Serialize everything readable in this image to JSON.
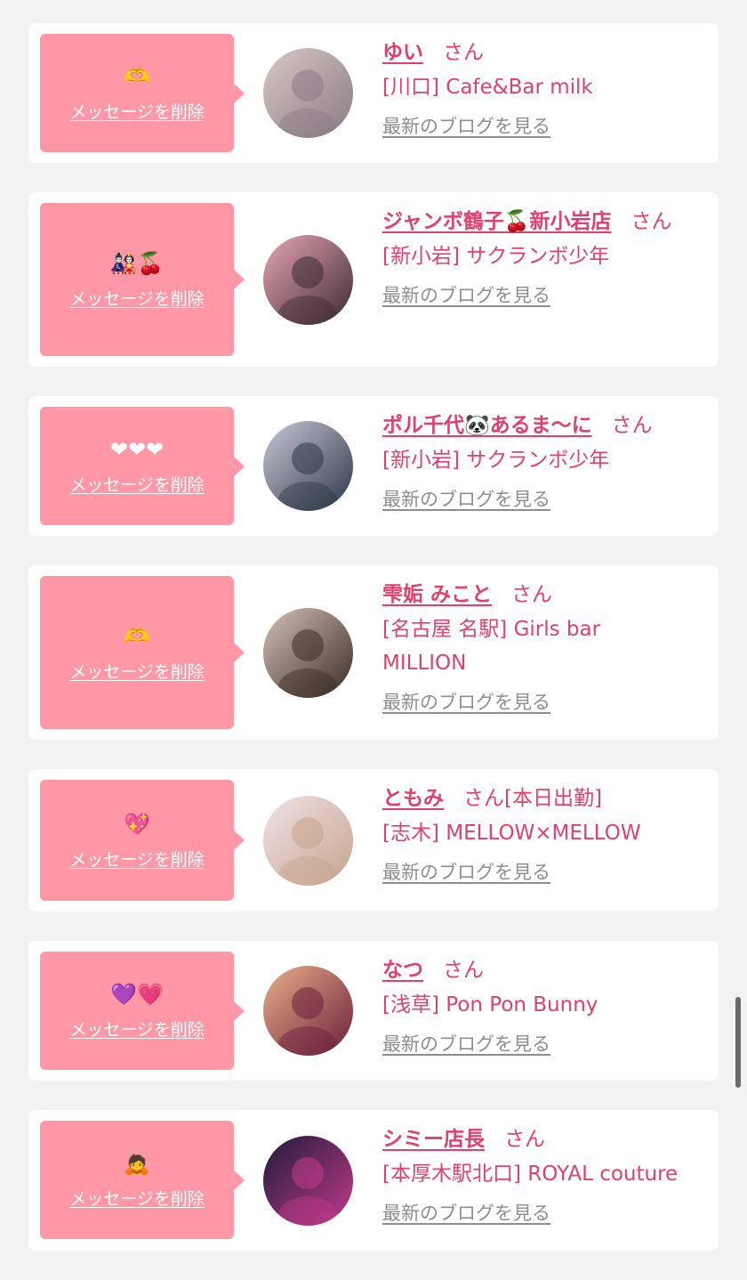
{
  "delete_label": "メッセージを削除",
  "blog_label": "最新のブログを見る",
  "san_label": "さん",
  "cards": [
    {
      "emoji": "🫶",
      "name": "ゆい",
      "suffix": "",
      "shop": "[川口] Cafe&Bar milk",
      "avatar_colors": [
        "#d8c9c4",
        "#8a7a86"
      ]
    },
    {
      "emoji": "🎎🍒",
      "name": "ジャンボ鶴子🍒新小岩店",
      "suffix": "",
      "shop": "[新小岩] サクランボ少年",
      "avatar_colors": [
        "#e8a6b4",
        "#3b2a33"
      ]
    },
    {
      "emoji": "❤❤❤",
      "name": "ポル千代🐼あるま〜に",
      "suffix": "",
      "shop": "[新小岩] サクランボ少年",
      "avatar_colors": [
        "#c9c8d6",
        "#2c3748"
      ]
    },
    {
      "emoji": "🫶",
      "name": "雫姤 みこと",
      "suffix": "",
      "shop": "[名古屋 名駅] Girls bar MILLION",
      "avatar_colors": [
        "#d6c2b6",
        "#3a2b26"
      ]
    },
    {
      "emoji": "💖",
      "name": "ともみ",
      "suffix": "[本日出勤]",
      "shop": "[志木] MELLOW×MELLOW",
      "avatar_colors": [
        "#efe3e6",
        "#c7a48e"
      ]
    },
    {
      "emoji": "💜💗",
      "name": "なつ",
      "suffix": "",
      "shop": "[浅草] Pon Pon Bunny",
      "avatar_colors": [
        "#e8b08a",
        "#6b1f3a"
      ]
    },
    {
      "emoji": "🙇",
      "name": "シミー店長",
      "suffix": "",
      "shop": "[本厚木駅北口] ROYAL couture",
      "avatar_colors": [
        "#1e1b3a",
        "#c23a8a"
      ]
    }
  ]
}
